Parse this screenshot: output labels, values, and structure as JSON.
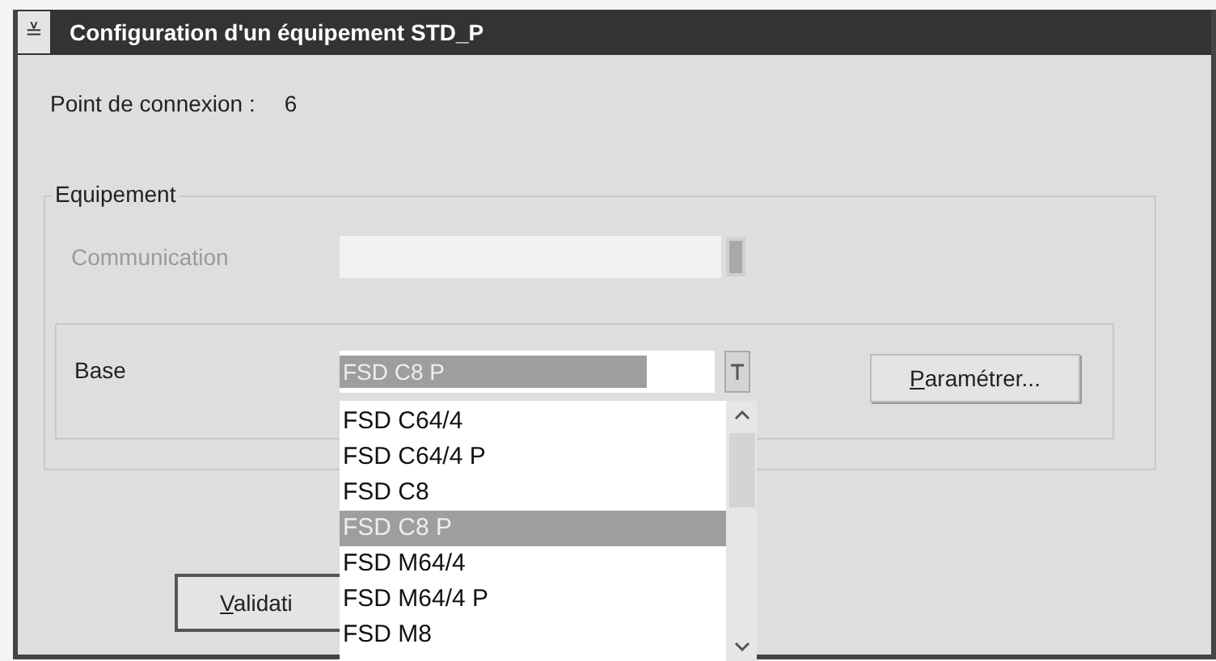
{
  "window": {
    "title": "Configuration d'un équipement STD_P",
    "system_menu": "≚"
  },
  "connection": {
    "label": "Point de connexion :",
    "value": "6"
  },
  "group": {
    "title": "Equipement",
    "communication": {
      "label": "Communication",
      "disabled": true
    },
    "base": {
      "label": "Base",
      "value": "FSD C8 P",
      "open": true,
      "options": [
        {
          "label": "FSD C64/4",
          "selected": false
        },
        {
          "label": "FSD C64/4 P",
          "selected": false
        },
        {
          "label": "FSD C8",
          "selected": false
        },
        {
          "label": "FSD C8 P",
          "selected": true
        },
        {
          "label": "FSD M64/4",
          "selected": false
        },
        {
          "label": "FSD M64/4 P",
          "selected": false
        },
        {
          "label": "FSD M8",
          "selected": false
        }
      ]
    },
    "configure_button": {
      "label": "Paramétrer...",
      "mnemonic": true
    }
  },
  "validate_button": {
    "label": "Validati",
    "mnemonic": true
  }
}
